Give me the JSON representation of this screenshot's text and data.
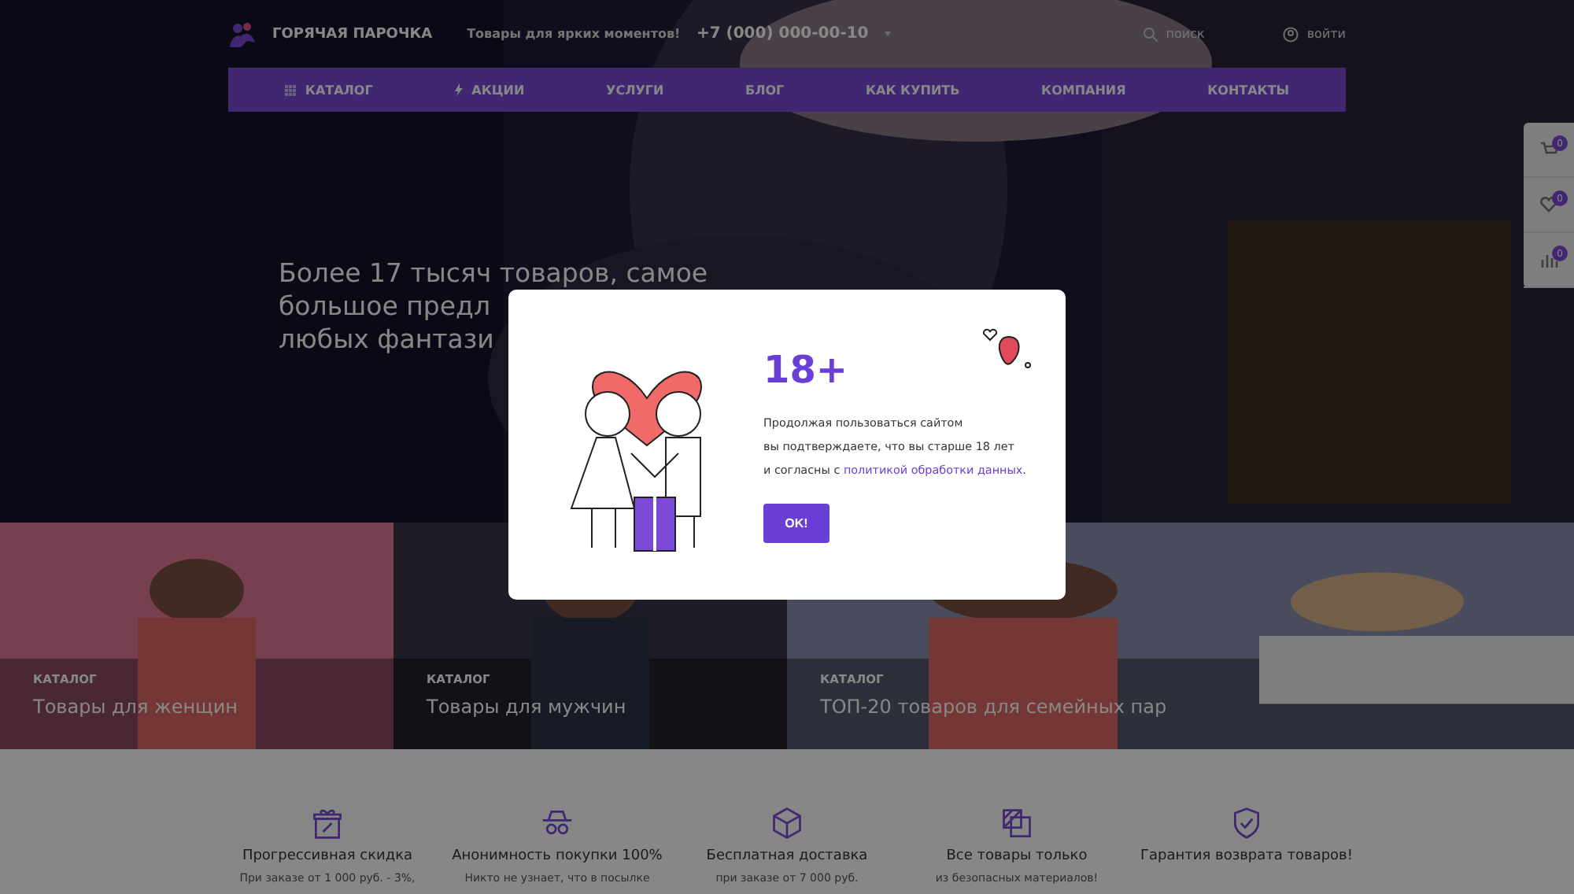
{
  "header": {
    "brand": "ГОРЯЧАЯ ПАРОЧКА",
    "tagline": "Товары для ярких моментов!",
    "phone": "+7 (000) 000-00-10",
    "search": "поиск",
    "login": "войти"
  },
  "nav": [
    {
      "label": "КАТАЛОГ"
    },
    {
      "label": "АКЦИИ"
    },
    {
      "label": "УСЛУГИ"
    },
    {
      "label": "БЛОГ"
    },
    {
      "label": "КАК КУПИТЬ"
    },
    {
      "label": "КОМПАНИЯ"
    },
    {
      "label": "КОНТАКТЫ"
    }
  ],
  "hero": {
    "lines": [
      "Более 17 тысяч товаров, самое",
      "большое предл",
      "любых фантази"
    ]
  },
  "side_panel": [
    {
      "kind": "cart",
      "count": "0"
    },
    {
      "kind": "favorites",
      "count": "0"
    },
    {
      "kind": "compare",
      "count": "0"
    }
  ],
  "categories": [
    {
      "caption": "КАТАЛОГ",
      "title": "Товары для женщин"
    },
    {
      "caption": "КАТАЛОГ",
      "title": "Товары для мужчин"
    },
    {
      "caption": "КАТАЛОГ",
      "title": "ТОП-20 товаров для семейных пар"
    }
  ],
  "features": [
    {
      "title": "Прогрессивная скидка",
      "text": "При заказе от 1 000 руб. - 3%,"
    },
    {
      "title": "Анонимность покупки 100%",
      "text": "Никто не узнает, что в посылке"
    },
    {
      "title": "Бесплатная доставка",
      "text": "при заказе от 7 000 руб."
    },
    {
      "title": "Все товары только",
      "text": "из безопасных материалов!"
    },
    {
      "title": "Гарантия возврата товаров!"
    }
  ],
  "modal": {
    "title": "18+",
    "lines": [
      "Продолжая пользоваться сайтом",
      "вы подтверждаете, что вы старше 18 лет"
    ],
    "line3": "и согласны с ",
    "link": "политикой обработки данных",
    "end": ".",
    "button": "OK!"
  }
}
